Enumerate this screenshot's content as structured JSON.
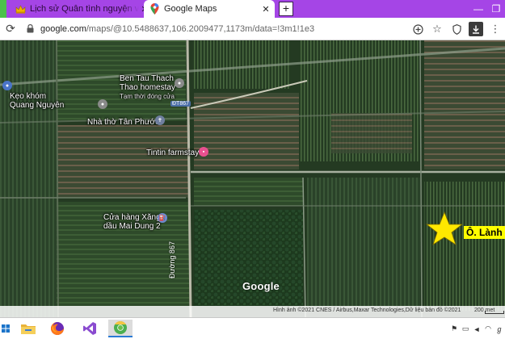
{
  "browser": {
    "tabs": [
      {
        "title": "Lịch sử Quân tình nguyện và c",
        "icon": "crown-icon",
        "active": false
      },
      {
        "title": "Google Maps",
        "icon": "maps-pin-icon",
        "active": true
      }
    ],
    "new_tab_label": "+",
    "window_controls": [
      "—",
      "❐",
      "✕"
    ],
    "url_host": "google.com",
    "url_path": "/maps/@10.5488637,106.2009477,1173m/data=!3m1!1e3"
  },
  "map": {
    "places": [
      {
        "name": "Kẹo khóm",
        "line2": "Quang Nguyên",
        "icon": "pin-icon"
      },
      {
        "name": "Ben Tau Thach",
        "line2": "Thao homestay",
        "note": "Tạm thời đóng cửa",
        "icon": "pin-icon"
      },
      {
        "name": "Nhà thờ Tân Phước",
        "icon": "church-icon"
      },
      {
        "name": "Tintin farmstay",
        "icon": "lodging-icon"
      },
      {
        "name": "Cửa hàng Xăng",
        "line2": "dầu Mai Dung 2",
        "icon": "fuel-icon"
      }
    ],
    "road_shield": "ĐT867",
    "street_name": "Đường 867",
    "marker_label": "Ô. Lành",
    "logo": "Google",
    "attribution": "Hình ảnh ©2021 CNES / Airbus,Maxar Technologies,Dữ liệu bản đồ ©2021",
    "scale": "200 met"
  },
  "toolbar_icons": [
    "add-circle-icon",
    "star-icon",
    "shield-icon",
    "download-icon",
    "menu-icon"
  ],
  "taskbar": {
    "apps": [
      "start-icon",
      "file-explorer-icon",
      "firefox-icon",
      "visual-studio-icon",
      "chrome-icon"
    ],
    "tray_icons": [
      "flag-icon",
      "speaker-icon",
      "volume-icon",
      "wifi-icon",
      "language-icon"
    ]
  }
}
